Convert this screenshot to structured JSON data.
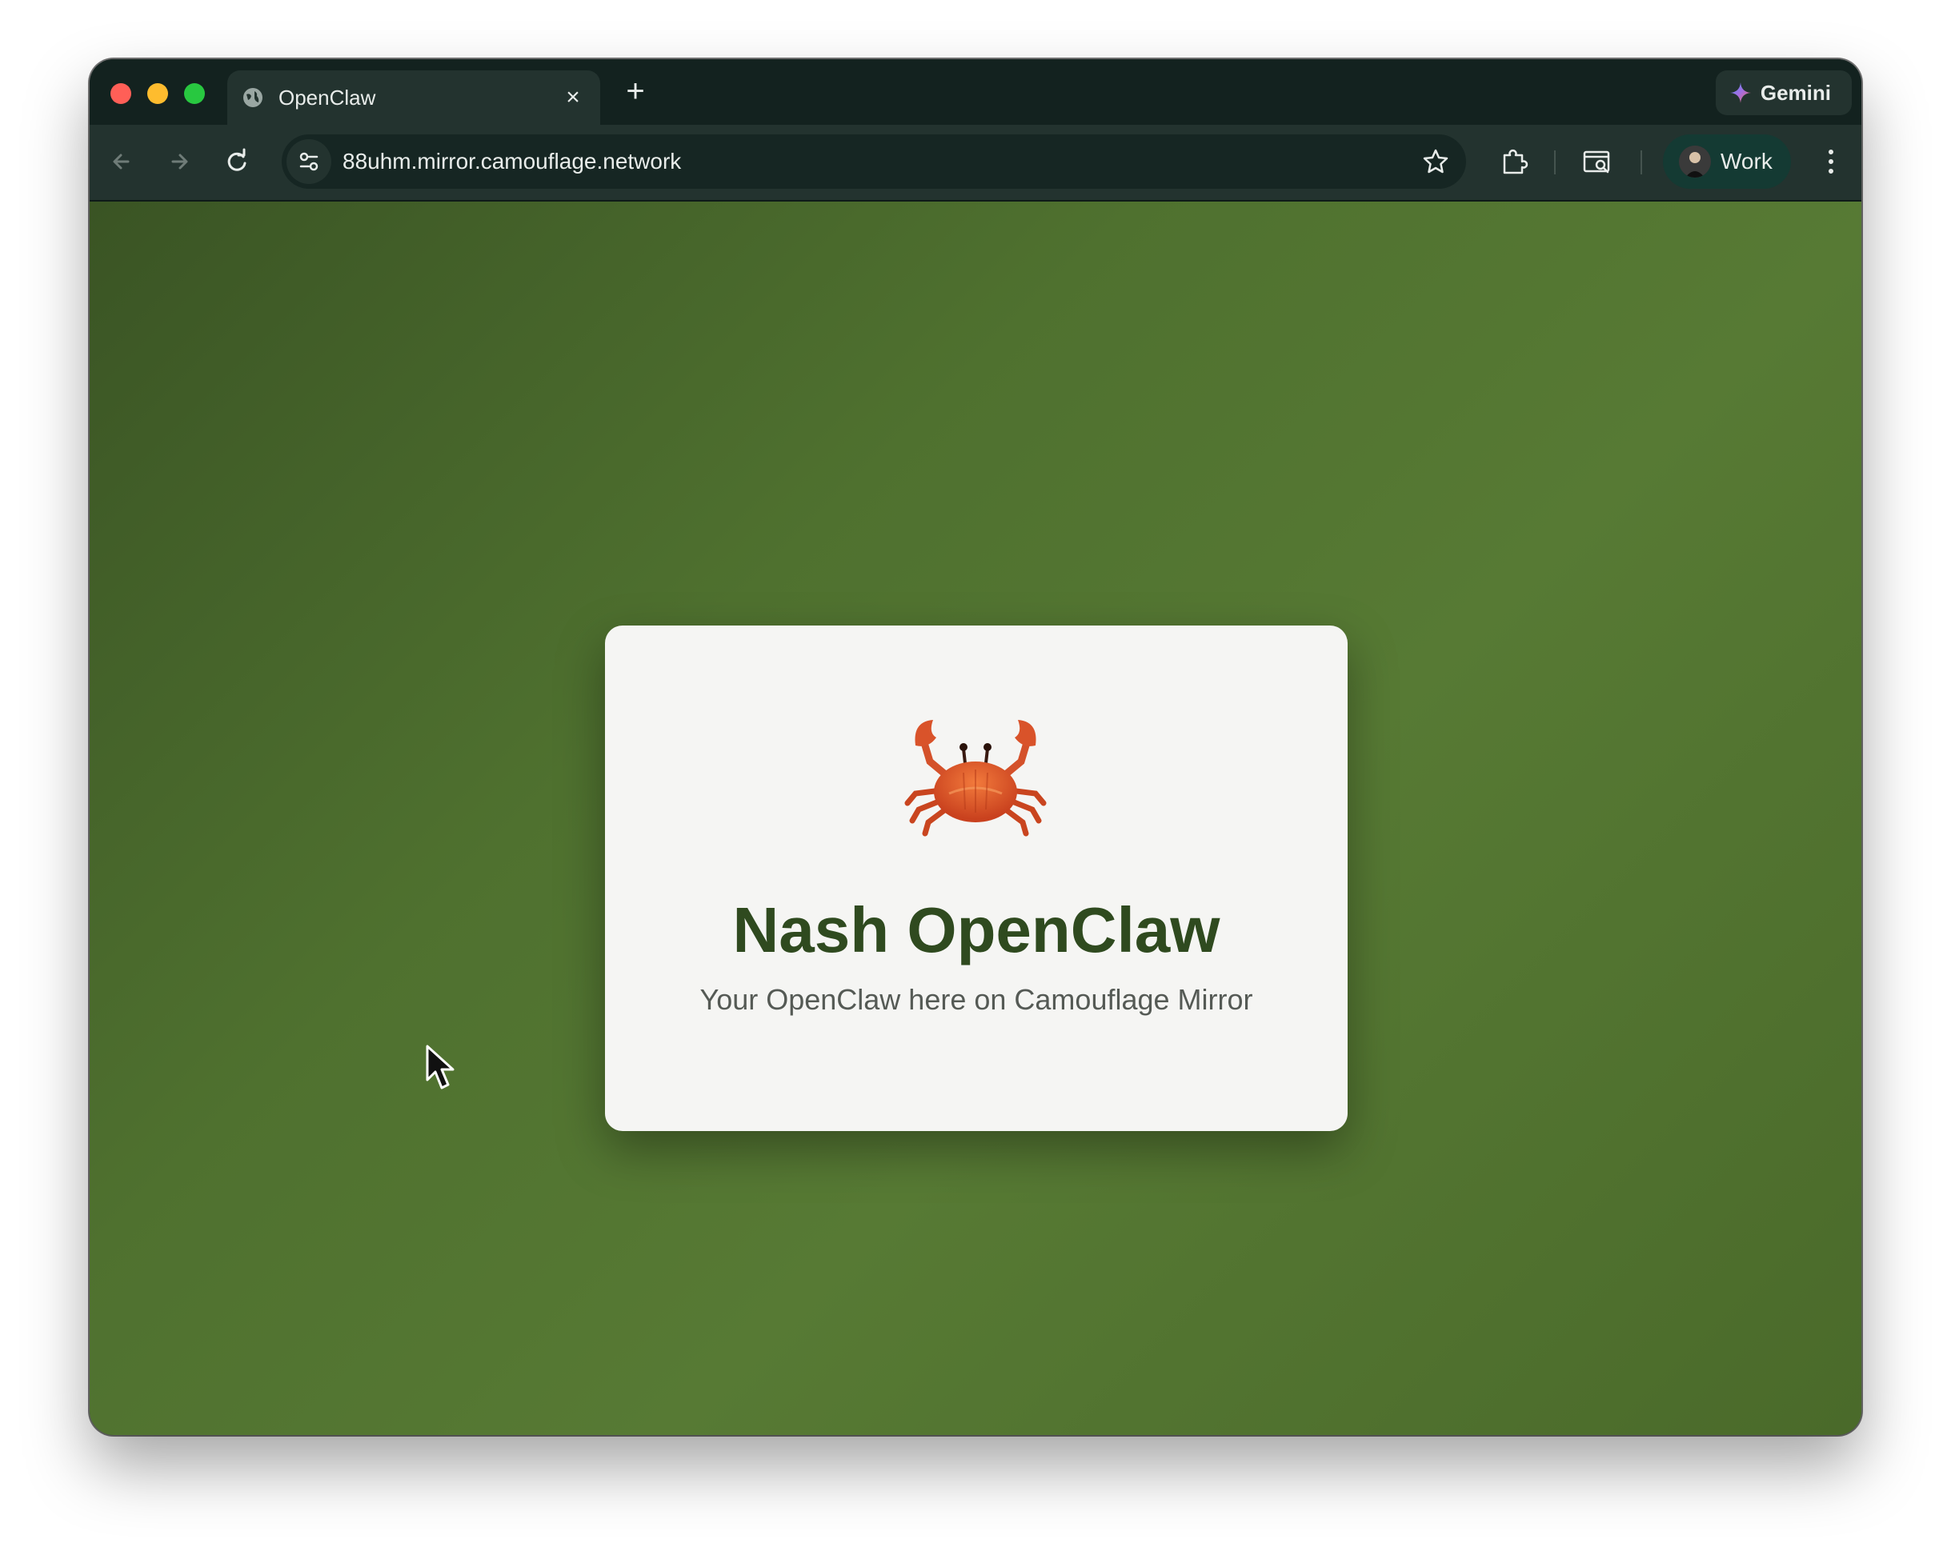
{
  "browser": {
    "tab": {
      "title": "OpenClaw",
      "close_label": "×"
    },
    "new_tab_label": "+",
    "gemini_label": "Gemini",
    "url": "88uhm.mirror.camouflage.network",
    "profile_label": "Work"
  },
  "page": {
    "icon": "crab-emoji",
    "title": "Nash OpenClaw",
    "subtitle": "Your OpenClaw here on Camouflage Mirror"
  },
  "colors": {
    "page_background": "#4f712f",
    "card_background": "#f5f5f3",
    "title_color": "#2f4a1f"
  }
}
